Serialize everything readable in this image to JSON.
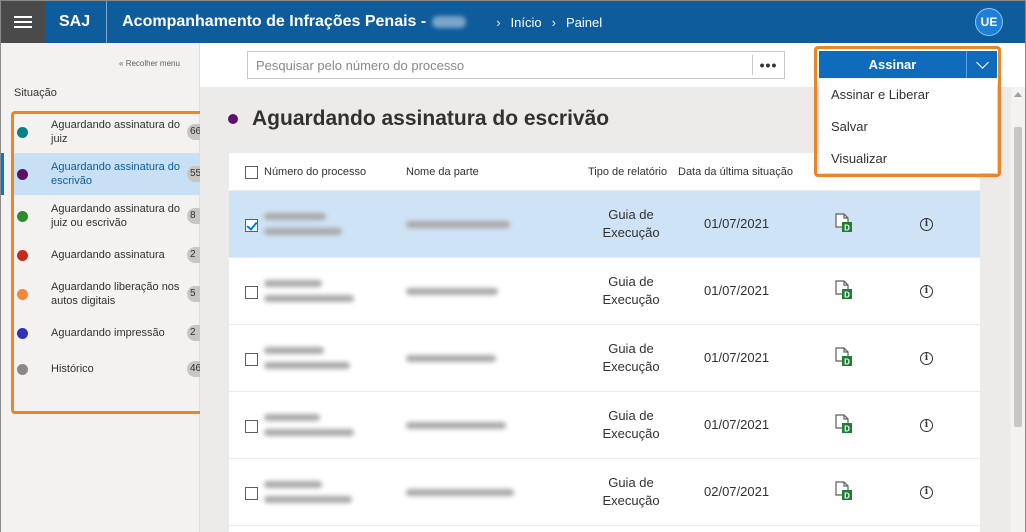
{
  "header": {
    "brand": "SAJ",
    "title": "Acompanhamento de Infrações Penais -",
    "breadcrumbs": [
      "Início",
      "Painel"
    ],
    "user_initials": "UE"
  },
  "sidebar": {
    "collapse_label": "Recolher menu",
    "section_label": "Situação",
    "items": [
      {
        "label": "Aguardando assinatura do juiz",
        "count": "66",
        "color": "#038387"
      },
      {
        "label": "Aguardando assinatura do escrivão",
        "count": "55",
        "color": "#5c126b",
        "selected": true
      },
      {
        "label": "Aguardando assinatura do juiz ou escrivão",
        "count": "8",
        "color": "#2e8b2e"
      },
      {
        "label": "Aguardando assinatura",
        "count": "2",
        "color": "#c42b1c"
      },
      {
        "label": "Aguardando liberação nos autos digitais",
        "count": "5",
        "color": "#f7853b"
      },
      {
        "label": "Aguardando impressão",
        "count": "2",
        "color": "#3232b8"
      },
      {
        "label": "Histórico",
        "count": "46",
        "color": "#8a8886"
      }
    ]
  },
  "search": {
    "placeholder": "Pesquisar pelo número do processo",
    "more_label": "•••"
  },
  "actions": {
    "primary_label": "Assinar",
    "menu": [
      "Assinar e Liberar",
      "Salvar",
      "Visualizar"
    ]
  },
  "section": {
    "title": "Aguardando assinatura do escrivão",
    "dot_color": "#5c126b"
  },
  "table": {
    "columns": [
      "Número do processo",
      "Nome da parte",
      "Tipo de relatório",
      "Data da última situação"
    ],
    "rows": [
      {
        "tipo": [
          "Guia de",
          "Execução"
        ],
        "data": "01/07/2021",
        "checked": true
      },
      {
        "tipo": [
          "Guia de",
          "Execução"
        ],
        "data": "01/07/2021",
        "checked": false
      },
      {
        "tipo": [
          "Guia de",
          "Execução"
        ],
        "data": "01/07/2021",
        "checked": false
      },
      {
        "tipo": [
          "Guia de",
          "Execução"
        ],
        "data": "01/07/2021",
        "checked": false
      },
      {
        "tipo": [
          "Guia de",
          "Execução"
        ],
        "data": "02/07/2021",
        "checked": false
      }
    ]
  },
  "icons": {
    "document": "document-d-icon",
    "info": "info-icon",
    "info_glyph": "i"
  },
  "colors": {
    "header_bg": "#0f5c9d",
    "primary_button": "#0f6cbd",
    "highlight": "#e8862a",
    "selected_row": "#cfe3f6"
  }
}
